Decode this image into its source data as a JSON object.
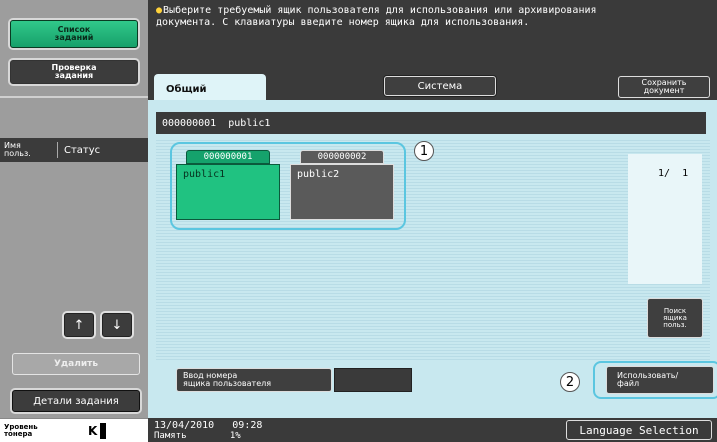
{
  "left_panel": {
    "job_list_label": "Список\nзаданий",
    "job_check_label": "Проверка\nзадания",
    "col_user": "Имя\nпольз.",
    "col_status": "Статус",
    "up_symbol": "🠕",
    "down_symbol": "🠗",
    "delete_label": "Удалить",
    "job_details_label": "Детали задания",
    "toner_label": "Уровень\nтонера",
    "toner_color": "K"
  },
  "message": {
    "icon": "bulb-icon",
    "text": "Выберите требуемый ящик пользователя для использования или архивирования документа. С клавиатуры введите номер ящика для использования."
  },
  "tabs": {
    "common": "Общий",
    "system": "Система",
    "save_document": "Сохранить\nдокумент"
  },
  "main": {
    "breadcrumb": "000000001  public1",
    "boxes": [
      {
        "number": "000000001",
        "name": "public1",
        "selected": true
      },
      {
        "number": "000000002",
        "name": "public2",
        "selected": false
      }
    ],
    "page_indicator": "1/  1",
    "search_box_label": "Поиск\nящика\nпольз.",
    "enter_number_label": "Ввод номера\nящика пользователя",
    "use_file_label": "Использовать/\nфайл",
    "callout1": "1",
    "callout2": "2"
  },
  "status": {
    "date": "13/04/2010",
    "time": "09:28",
    "memory_label": "Память",
    "memory_value": "1%",
    "language_button": "Language Selection"
  },
  "colors": {
    "accent_green": "#20c281",
    "highlight_blue": "#5bc6e0",
    "panel_bg": "#c8e8ef"
  }
}
